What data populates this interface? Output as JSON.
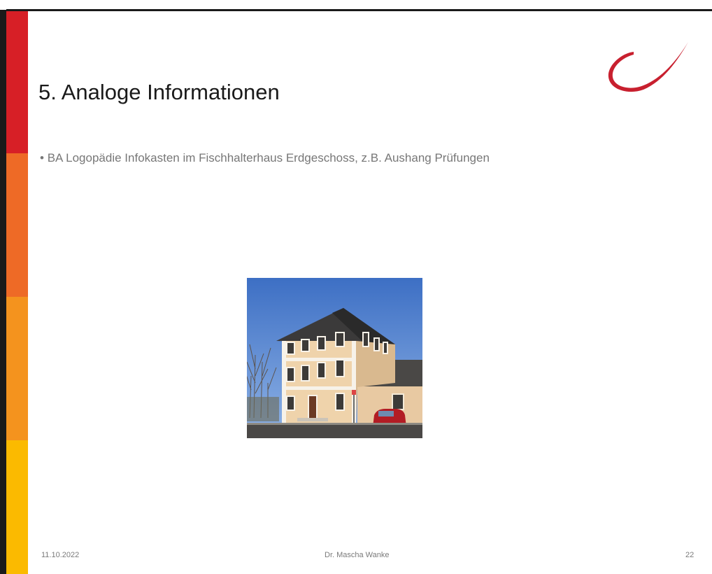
{
  "slide": {
    "title": "5. Analoge Informationen",
    "bullet_marker": "•",
    "bullet_text": "BA Logopädie Infokasten im Fischhalterhaus Erdgeschoss, z.B.  Aushang Prüfungen"
  },
  "footer": {
    "date": "11.10.2022",
    "author": "Dr. Mascha Wanke",
    "page_number": "22"
  },
  "colors": {
    "band_red": "#D71F26",
    "band_orange": "#EE6A26",
    "band_amber": "#F4931E",
    "band_yellow": "#FBBA00",
    "logo_red": "#C8202F"
  },
  "icons": {
    "logo": "swoosh-logo",
    "photo": "building-photo"
  }
}
